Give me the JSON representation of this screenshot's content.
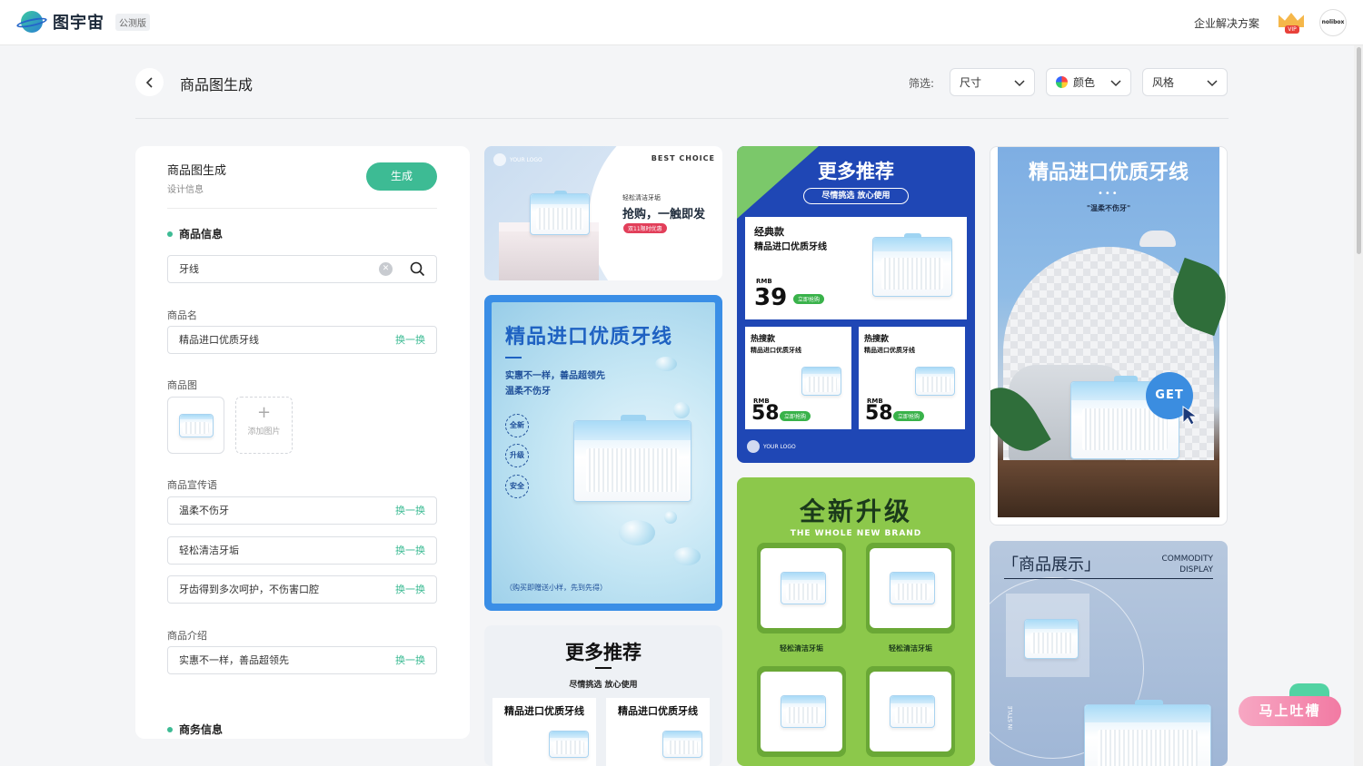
{
  "app": {
    "name": "图宇宙",
    "beta": "公测版",
    "enterprise": "企业解决方案",
    "vip": "VIP",
    "avatar": "nolibox"
  },
  "header": {
    "title": "商品图生成",
    "filter_label": "筛选:",
    "filters": [
      "尺寸",
      "颜色",
      "风格"
    ]
  },
  "form": {
    "title": "商品图生成",
    "subtitle": "设计信息",
    "generate": "生成",
    "section_product": "商品信息",
    "search_value": "牙线",
    "name_label": "商品名",
    "name_value": "精品进口优质牙线",
    "swap": "换一换",
    "image_label": "商品图",
    "add_image": "添加图片",
    "slogan_label": "商品宣传语",
    "slogans": [
      "温柔不伤牙",
      "轻松清洁牙垢",
      "牙齿得到多次呵护，不伤害口腔"
    ],
    "intro_label": "商品介绍",
    "intro_value": "实惠不一样，善品超领先",
    "section_business": "商务信息"
  },
  "cards": {
    "c1": {
      "logo": "YOUR LOGO",
      "best": "BEST CHOICE",
      "s1": "轻松清洁牙垢",
      "s2": "抢购，一触即发",
      "s3": "双11限时优惠"
    },
    "c2": {
      "title": "精品进口优质牙线",
      "l1": "实惠不一样，善品超领先",
      "l2": "温柔不伤牙",
      "badges": [
        "全新",
        "升级",
        "安全"
      ],
      "foot": "（购买即赠送小样，先到先得）"
    },
    "c3": {
      "title": "更多推荐",
      "sub": "尽情挑选 放心使用",
      "box": "精品进口优质牙线"
    },
    "c4": {
      "title": "更多推荐",
      "pill": "尽情挑选 放心使用",
      "main_a": "经典款",
      "main_b": "精品进口优质牙线",
      "rmb": "RMB",
      "main_price": "39",
      "buy": "立即抢购",
      "sm_a": "热搜款",
      "sm_b": "精品进口优质牙线",
      "sm_price": "58",
      "logo": "YOUR LOGO"
    },
    "c5": {
      "title": "全新升级",
      "sub": "THE WHOLE NEW BRAND",
      "label": "轻松清洁牙垢"
    },
    "c6": {
      "title": "精品进口优质牙线",
      "dots": "•••",
      "quote": "\"温柔不伤牙\"",
      "get": "GET"
    },
    "c7": {
      "title": "「商品展示」",
      "en1": "COMMODITY",
      "en2": "DISPLAY",
      "side": "IN STYLE"
    }
  },
  "feedback": "马上吐槽",
  "colors": {
    "accent": "#3dbb94",
    "brand_blue": "#1f47b5",
    "green_card": "#8cc84b"
  }
}
